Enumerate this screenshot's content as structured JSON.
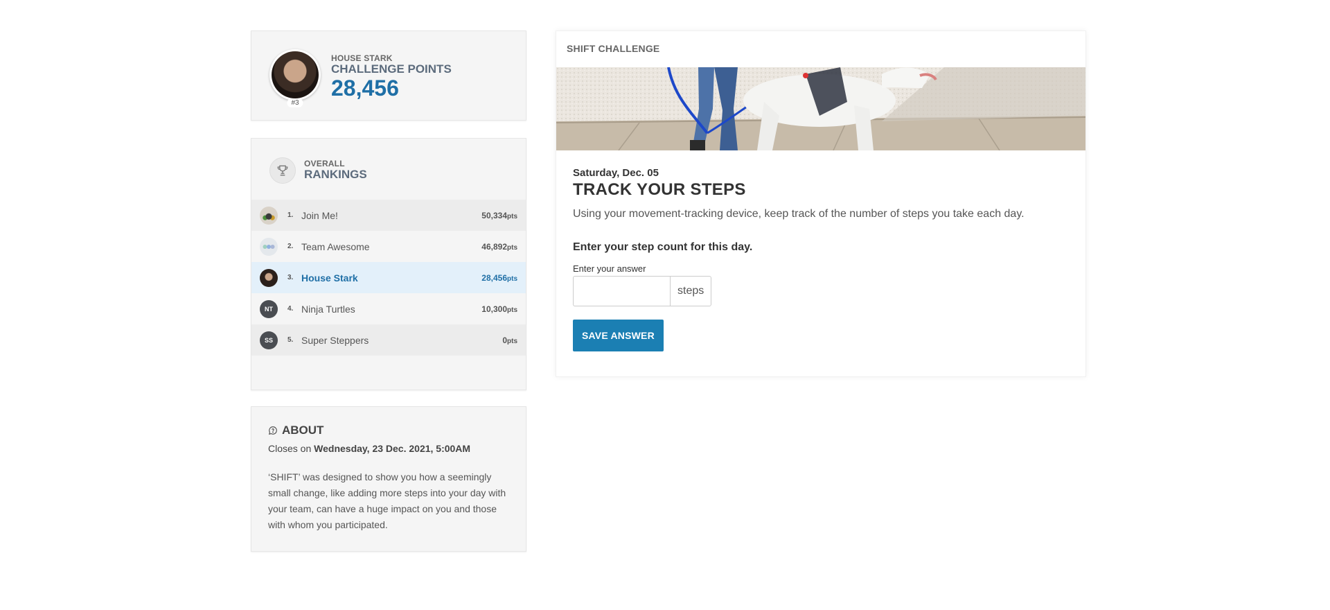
{
  "profile": {
    "house": "HOUSE STARK",
    "points_title": "CHALLENGE POINTS",
    "points_value": "28,456",
    "rank_badge": "#3"
  },
  "rankings": {
    "eyebrow": "OVERALL",
    "title": "RANKINGS",
    "pts_suffix": "pts",
    "teams": [
      {
        "rank": "1.",
        "name": "Join Me!",
        "points": "50,334",
        "avatar_initials": ""
      },
      {
        "rank": "2.",
        "name": "Team Awesome",
        "points": "46,892",
        "avatar_initials": ""
      },
      {
        "rank": "3.",
        "name": "House Stark",
        "points": "28,456",
        "avatar_initials": ""
      },
      {
        "rank": "4.",
        "name": "Ninja Turtles",
        "points": "10,300",
        "avatar_initials": "NT"
      },
      {
        "rank": "5.",
        "name": "Super Steppers",
        "points": "0",
        "avatar_initials": "SS"
      }
    ]
  },
  "about": {
    "title": "ABOUT",
    "closes_prefix": "Closes on",
    "closes_date": "Wednesday, 23 Dec. 2021, 5:00AM",
    "description": "‘SHIFT’ was designed to show you how a seemingly small change, like adding more steps into your day with your team, can have a huge impact on you and those with whom you participated."
  },
  "challenge": {
    "label": "SHIFT CHALLENGE",
    "date": "Saturday, Dec. 05",
    "title": "TRACK YOUR STEPS",
    "description": "Using your movement-tracking device, keep track of the number of steps you take each day.",
    "question": "Enter your step count for this day.",
    "answer_label": "Enter your answer",
    "answer_value": "",
    "unit": "steps",
    "save_label": "SAVE ANSWER"
  },
  "colors": {
    "accent": "#1f6fa6",
    "button": "#1b7fb3",
    "active_row": "#e3f0fa"
  },
  "icons": {
    "trophy": "trophy-icon",
    "about": "chat-bubble-icon"
  }
}
